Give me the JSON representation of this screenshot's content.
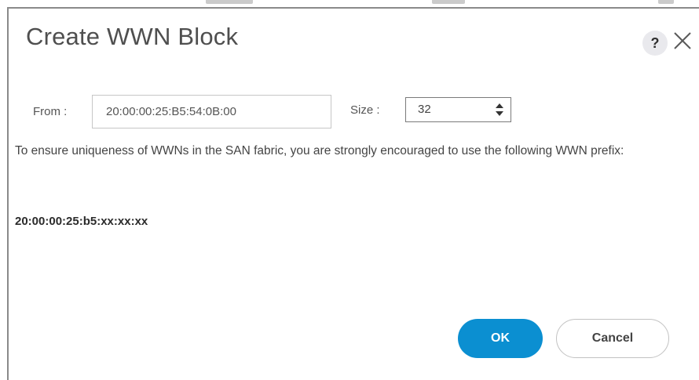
{
  "dialog": {
    "title": "Create WWN Block",
    "help_icon": "help-icon",
    "help_glyph": "?",
    "close_icon": "close-icon"
  },
  "form": {
    "from_label": "From :",
    "from_value": "20:00:00:25:B5:54:0B:00",
    "size_label": "Size :",
    "size_value": "32"
  },
  "info": {
    "note": "To ensure uniqueness of WWNs in the SAN fabric, you are strongly encouraged to use the following WWN prefix:",
    "prefix": "20:00:00:25:b5:xx:xx:xx"
  },
  "buttons": {
    "ok_label": "OK",
    "cancel_label": "Cancel"
  },
  "colors": {
    "primary_button": "#0b8fd1",
    "title_text": "#4f4f4f",
    "help_bg": "#e9e9ed"
  }
}
